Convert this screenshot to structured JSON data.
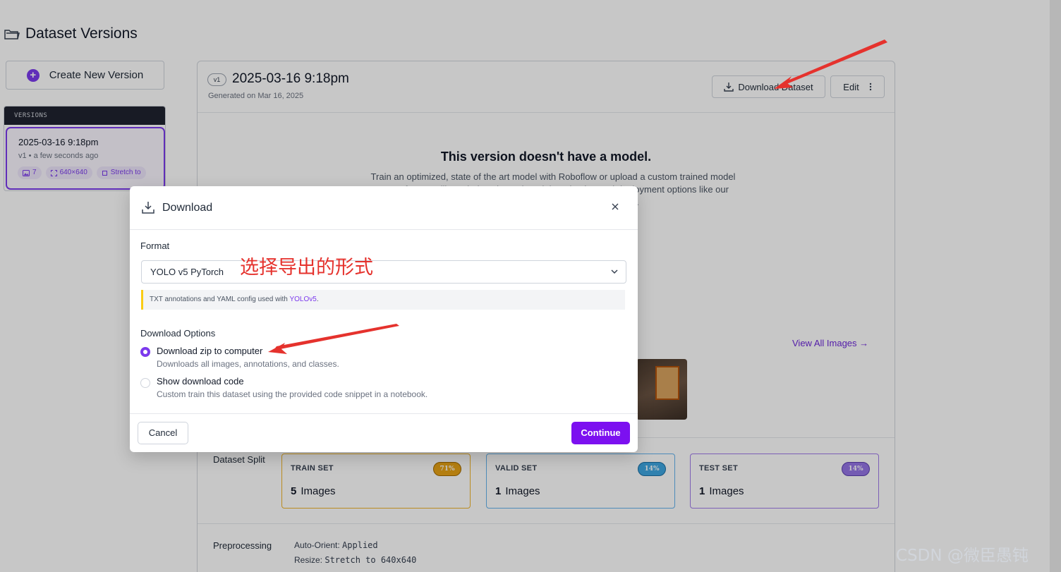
{
  "page": {
    "title": "Dataset Versions",
    "create_button": "Create New Version"
  },
  "versions": {
    "header": "VERSIONS",
    "items": [
      {
        "title": "2025-03-16 9:18pm",
        "subtitle": "v1 • a few seconds ago",
        "chips": [
          "7",
          "640×640",
          "Stretch to"
        ]
      }
    ]
  },
  "version_header": {
    "badge": "v1",
    "title": "2025-03-16 9:18pm",
    "generated": "Generated on Mar 16, 2025",
    "download_button": "Download Dataset",
    "edit_button": "Edit"
  },
  "no_model": {
    "title": "This version doesn't have a model.",
    "text": "Train an optimized, state of the art model with Roboflow or upload a custom trained model to use features like Label Assist and Model Evaluation and deployment options like our auto-scaling API and edge device support."
  },
  "images": {
    "view_all": "View All Images →"
  },
  "split": {
    "label": "Dataset Split",
    "sets": [
      {
        "name": "TRAIN SET",
        "percent": "71%",
        "count": "5",
        "unit": "Images"
      },
      {
        "name": "VALID SET",
        "percent": "14%",
        "count": "1",
        "unit": "Images"
      },
      {
        "name": "TEST SET",
        "percent": "14%",
        "count": "1",
        "unit": "Images"
      }
    ]
  },
  "preprocessing": {
    "label": "Preprocessing",
    "lines": [
      {
        "key": "Auto-Orient:",
        "value": "Applied"
      },
      {
        "key": "Resize:",
        "value": "Stretch to 640x640"
      }
    ]
  },
  "modal": {
    "title": "Download",
    "format_label": "Format",
    "format_value": "YOLO v5 PyTorch",
    "format_note": "TXT annotations and YAML config used with",
    "format_note_link": "YOLOv5",
    "options_label": "Download Options",
    "options": [
      {
        "title": "Download zip to computer",
        "description": "Downloads all images, annotations, and classes.",
        "selected": true
      },
      {
        "title": "Show download code",
        "description": "Custom train this dataset using the provided code snippet in a notebook.",
        "selected": false
      }
    ],
    "cancel": "Cancel",
    "continue": "Continue"
  },
  "annotations": {
    "note": "选择导出的形式",
    "watermark": "CSDN @微臣愚钝"
  },
  "colors": {
    "accent": "#7c3aed",
    "continue": "#7c10f0",
    "annotation_red": "#e5322d",
    "train": "#e8a317",
    "valid": "#3ea6e0",
    "test": "#9575e6"
  }
}
